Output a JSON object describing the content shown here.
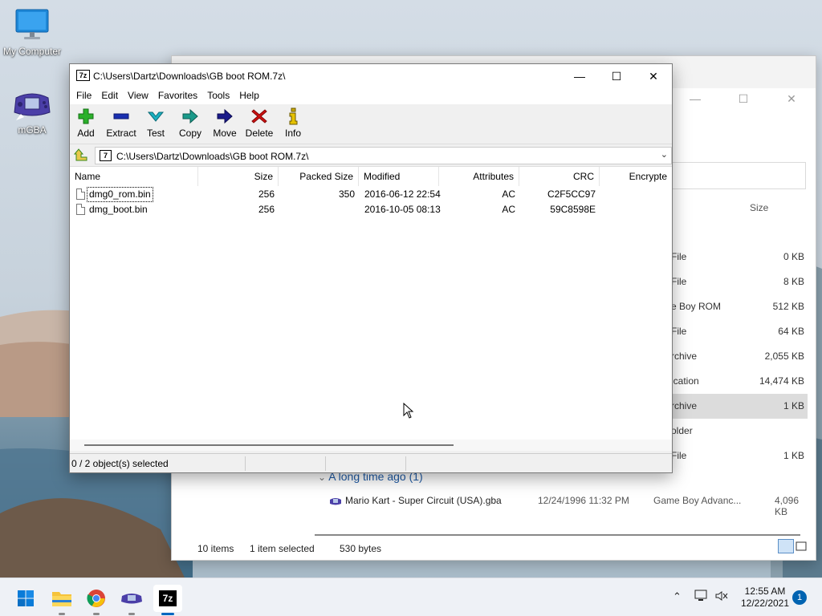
{
  "desktop": {
    "icons": [
      {
        "label": "My Computer",
        "icon": "monitor-icon"
      },
      {
        "label": "mGBA",
        "icon": "gba-icon"
      }
    ]
  },
  "explorer": {
    "controls": {
      "minimize": "—",
      "maximize": "☐",
      "close": "✕"
    },
    "size_header": "Size",
    "rows": [
      {
        "type": "File",
        "size": "0 KB",
        "selected": false
      },
      {
        "type": "File",
        "size": "8 KB",
        "selected": false
      },
      {
        "type": "e Boy ROM",
        "size": "512 KB",
        "selected": false
      },
      {
        "type": "File",
        "size": "64 KB",
        "selected": false
      },
      {
        "type": "rchive",
        "size": "2,055 KB",
        "selected": false
      },
      {
        "type": "ication",
        "size": "14,474 KB",
        "selected": false
      },
      {
        "type": "rchive",
        "size": "1 KB",
        "selected": true
      },
      {
        "type": "older",
        "size": "",
        "selected": false
      },
      {
        "type": "File",
        "size": "1 KB",
        "selected": false
      }
    ],
    "group_label": "A long time ago (1)",
    "file": {
      "name": "Mario Kart - Super Circuit (USA).gba",
      "date": "12/24/1996 11:32 PM",
      "type": "Game Boy Advanc...",
      "size": "4,096 KB"
    },
    "status": {
      "items": "10 items",
      "selected": "1 item selected",
      "bytes": "530 bytes"
    }
  },
  "sevenzip": {
    "title": "C:\\Users\\Dartz\\Downloads\\GB boot ROM.7z\\",
    "app_icon": "7z",
    "controls": {
      "minimize": "—",
      "maximize": "☐",
      "close": "✕"
    },
    "menu": [
      "File",
      "Edit",
      "View",
      "Favorites",
      "Tools",
      "Help"
    ],
    "toolbar": [
      {
        "label": "Add",
        "icon": "add-icon",
        "color": "#2bb02b"
      },
      {
        "label": "Extract",
        "icon": "extract-icon",
        "color": "#1a2fb0"
      },
      {
        "label": "Test",
        "icon": "test-icon",
        "color": "#1ab0b0"
      },
      {
        "label": "Copy",
        "icon": "copy-icon",
        "color": "#1a9a8a"
      },
      {
        "label": "Move",
        "icon": "move-icon",
        "color": "#1a1a8a"
      },
      {
        "label": "Delete",
        "icon": "delete-icon",
        "color": "#d01010"
      },
      {
        "label": "Info",
        "icon": "info-icon",
        "color": "#c8a800"
      }
    ],
    "address": "C:\\Users\\Dartz\\Downloads\\GB boot ROM.7z\\",
    "columns": [
      "Name",
      "Size",
      "Packed Size",
      "Modified",
      "Attributes",
      "CRC",
      "Encrypte"
    ],
    "files": [
      {
        "name": "dmg0_rom.bin",
        "size": "256",
        "packed": "350",
        "modified": "2016-06-12 22:54",
        "attributes": "AC",
        "crc": "C2F5CC97"
      },
      {
        "name": "dmg_boot.bin",
        "size": "256",
        "packed": "",
        "modified": "2016-10-05 08:13",
        "attributes": "AC",
        "crc": "59C8598E"
      }
    ],
    "status": "0 / 2 object(s) selected"
  },
  "taskbar": {
    "apps": [
      {
        "name": "start",
        "icon": "windows-start-icon"
      },
      {
        "name": "file-explorer",
        "icon": "folder-icon"
      },
      {
        "name": "chrome",
        "icon": "chrome-icon"
      },
      {
        "name": "mgba",
        "icon": "gba-icon"
      },
      {
        "name": "7-zip",
        "icon": "7z-icon",
        "label": "7z"
      }
    ],
    "clock": {
      "time": "12:55 AM",
      "date": "12/22/2021"
    },
    "notification_count": "1"
  }
}
